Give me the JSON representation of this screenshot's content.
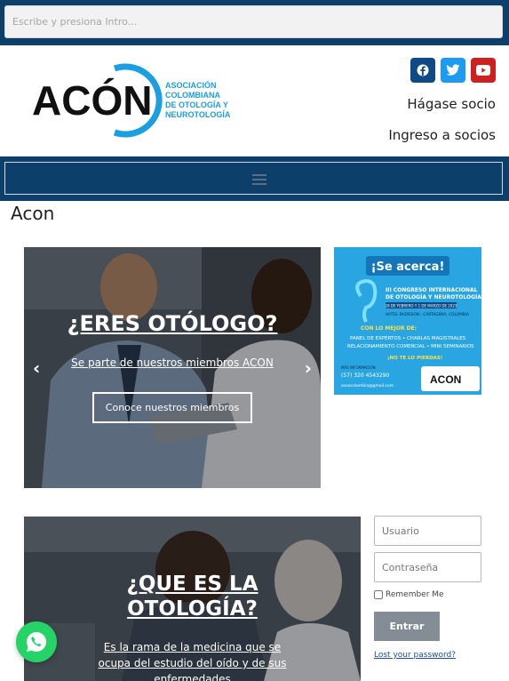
{
  "search": {
    "placeholder": "Escribe y presiona Intro..."
  },
  "header": {
    "logo_text": "ACÓN",
    "logo_subtitle": [
      "ASOCIACIÓN",
      "COLOMBIANA",
      "DE OTOLOGÍA Y",
      "NEUROTOLOGÍA"
    ],
    "social": [
      "facebook-icon",
      "twitter-icon",
      "youtube-icon"
    ],
    "links": [
      "Hágase socio",
      "Ingreso a socios"
    ]
  },
  "page": {
    "title": "Acon"
  },
  "hero": {
    "title": "¿ERES OTÓLOGO?",
    "subtitle": "Se parte de nuestros miembros ACON",
    "button": "Conoce nuestros miembros",
    "prev": "‹",
    "next": "›"
  },
  "ad": {
    "headline": "¡Se acerca!",
    "event_line1": "III CONGRESO INTERNACIONAL",
    "event_line2": "DE OTOLOGÍA Y NEUROTOLOGÍA",
    "dates": "28 DE FEBRERO Y 1 DE MARZO DE 2023",
    "venue": "HOTEL RADISSON - CARTAGENA, COLOMBIA",
    "best_label": "CON LO MEJOR DE:",
    "features1": "PANEL DE EXPERTOS • CHARLAS MAGISTRALES",
    "features2": "RELACIONAMIENTO COMERCIAL • MINI SEMINARIOS",
    "cta": "¡NO TE LO PIERDAS!",
    "info_label": "MÁS INFORMACIÓN",
    "phone": "(57) 320 4543290",
    "email": "asoacolombia@gmail.com",
    "logo": "ACON"
  },
  "section2": {
    "title_line1": "¿QUE ES LA",
    "title_line2": "OTOLOGÍA?",
    "text_line1": "Es la rama de la medicina que se",
    "text_line2": "ocupa del estudio del oído y de sus",
    "text_line3": "enfermedades"
  },
  "login": {
    "user_placeholder": "Usuario",
    "pass_placeholder": "Contraseña",
    "remember": "Remember Me",
    "submit": "Entrar",
    "lost": "Lost your password?"
  },
  "colors": {
    "navy": "#0d3f6b",
    "accent_blue": "#1a9fe0"
  }
}
